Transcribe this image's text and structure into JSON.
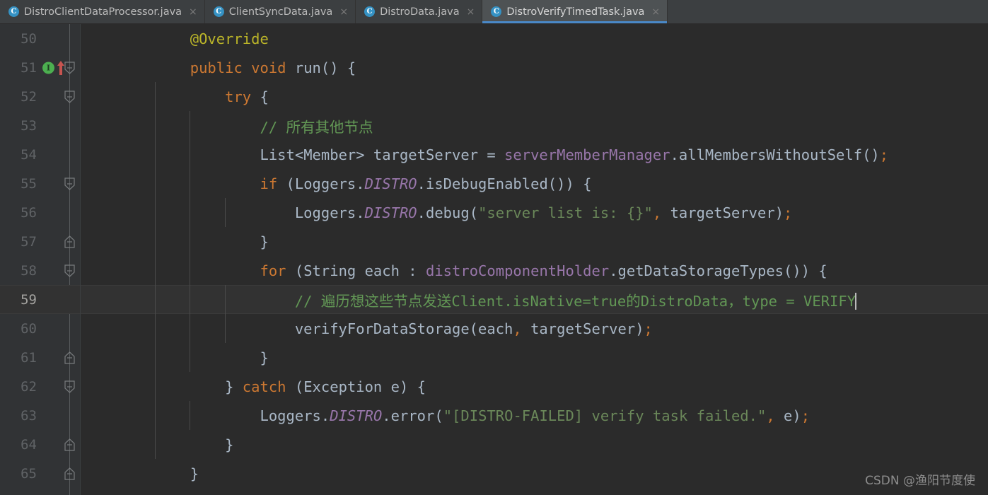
{
  "window": {
    "theme": "darcula",
    "colors": {
      "editor_bg": "#2b2b2b",
      "gutter_bg": "#313335",
      "tabbar_bg": "#3c3f41",
      "active_tab_bg": "#4e5254",
      "active_tab_underline": "#4a88c7",
      "current_line_bg": "#323232",
      "keyword": "#cc7832",
      "annotation": "#bbb529",
      "comment": "#629755",
      "string": "#6a8759",
      "field": "#9876aa",
      "default_text": "#a9b7c6",
      "line_number": "#606366",
      "current_line_number": "#a4a3a0",
      "implements_marker": "#4caf50",
      "modified_marker": "#c75450"
    }
  },
  "tabs": [
    {
      "label": "DistroClientDataProcessor.java",
      "icon": "java-class-icon",
      "icon_letter": "C",
      "close_glyph": "×",
      "active": false
    },
    {
      "label": "ClientSyncData.java",
      "icon": "java-class-icon",
      "icon_letter": "C",
      "close_glyph": "×",
      "active": false
    },
    {
      "label": "DistroData.java",
      "icon": "java-class-icon",
      "icon_letter": "C",
      "close_glyph": "×",
      "active": false
    },
    {
      "label": "DistroVerifyTimedTask.java",
      "icon": "java-class-icon",
      "icon_letter": "C",
      "close_glyph": "×",
      "active": true
    }
  ],
  "editor": {
    "current_line": 59,
    "caret_line": 59,
    "caret_column_after": "VERIFY",
    "lines": [
      {
        "number": "50",
        "current": false,
        "fold": null,
        "markers": [],
        "indent_guides": [],
        "tokens": [
          {
            "t": "        ",
            "c": "plain"
          },
          {
            "t": "@Override",
            "c": "anno"
          }
        ]
      },
      {
        "number": "51",
        "current": false,
        "fold": "start",
        "markers": [
          "implements-marker",
          "modified-arrow-marker"
        ],
        "indent_guides": [],
        "tokens": [
          {
            "t": "        ",
            "c": "plain"
          },
          {
            "t": "public",
            "c": "kw"
          },
          {
            "t": " ",
            "c": "plain"
          },
          {
            "t": "void",
            "c": "kw"
          },
          {
            "t": " ",
            "c": "plain"
          },
          {
            "t": "run",
            "c": "plain"
          },
          {
            "t": "() {",
            "c": "plain"
          }
        ]
      },
      {
        "number": "52",
        "current": false,
        "fold": "start",
        "markers": [],
        "indent_guides": [
          1
        ],
        "tokens": [
          {
            "t": "            ",
            "c": "plain"
          },
          {
            "t": "try",
            "c": "kw"
          },
          {
            "t": " {",
            "c": "plain"
          }
        ]
      },
      {
        "number": "53",
        "current": false,
        "fold": null,
        "markers": [],
        "indent_guides": [
          1,
          2
        ],
        "tokens": [
          {
            "t": "                ",
            "c": "plain"
          },
          {
            "t": "// 所有其他节点",
            "c": "cmt"
          }
        ]
      },
      {
        "number": "54",
        "current": false,
        "fold": null,
        "markers": [],
        "indent_guides": [
          1,
          2
        ],
        "tokens": [
          {
            "t": "                ",
            "c": "plain"
          },
          {
            "t": "List<Member> targetServer = ",
            "c": "plain"
          },
          {
            "t": "serverMemberManager",
            "c": "fld"
          },
          {
            "t": ".allMembersWithoutSelf()",
            "c": "plain"
          },
          {
            "t": ";",
            "c": "semi"
          }
        ]
      },
      {
        "number": "55",
        "current": false,
        "fold": "start",
        "markers": [],
        "indent_guides": [
          1,
          2
        ],
        "tokens": [
          {
            "t": "                ",
            "c": "plain"
          },
          {
            "t": "if",
            "c": "kw"
          },
          {
            "t": " (Loggers.",
            "c": "plain"
          },
          {
            "t": "DISTRO",
            "c": "sfld"
          },
          {
            "t": ".isDebugEnabled()) {",
            "c": "plain"
          }
        ]
      },
      {
        "number": "56",
        "current": false,
        "fold": null,
        "markers": [],
        "indent_guides": [
          1,
          2,
          3
        ],
        "tokens": [
          {
            "t": "                    ",
            "c": "plain"
          },
          {
            "t": "Loggers.",
            "c": "plain"
          },
          {
            "t": "DISTRO",
            "c": "sfld"
          },
          {
            "t": ".debug(",
            "c": "plain"
          },
          {
            "t": "\"server list is: {}\"",
            "c": "str"
          },
          {
            "t": ",",
            "c": "semi"
          },
          {
            "t": " targetServer)",
            "c": "plain"
          },
          {
            "t": ";",
            "c": "semi"
          }
        ]
      },
      {
        "number": "57",
        "current": false,
        "fold": "end",
        "markers": [],
        "indent_guides": [
          1,
          2
        ],
        "tokens": [
          {
            "t": "                }",
            "c": "plain"
          }
        ]
      },
      {
        "number": "58",
        "current": false,
        "fold": "start",
        "markers": [],
        "indent_guides": [
          1,
          2
        ],
        "tokens": [
          {
            "t": "                ",
            "c": "plain"
          },
          {
            "t": "for",
            "c": "kw"
          },
          {
            "t": " (String each : ",
            "c": "plain"
          },
          {
            "t": "distroComponentHolder",
            "c": "fld"
          },
          {
            "t": ".getDataStorageTypes()) {",
            "c": "plain"
          }
        ]
      },
      {
        "number": "59",
        "current": true,
        "fold": null,
        "markers": [],
        "indent_guides": [
          1,
          2,
          3
        ],
        "tokens": [
          {
            "t": "                    ",
            "c": "plain"
          },
          {
            "t": "// 遍历想这些节点发送Client.isNative=true的DistroData，type = VERIFY",
            "c": "cmt"
          }
        ]
      },
      {
        "number": "60",
        "current": false,
        "fold": null,
        "markers": [],
        "indent_guides": [
          1,
          2,
          3
        ],
        "tokens": [
          {
            "t": "                    ",
            "c": "plain"
          },
          {
            "t": "verifyForDataStorage(each",
            "c": "plain"
          },
          {
            "t": ",",
            "c": "semi"
          },
          {
            "t": " targetServer)",
            "c": "plain"
          },
          {
            "t": ";",
            "c": "semi"
          }
        ]
      },
      {
        "number": "61",
        "current": false,
        "fold": "end",
        "markers": [],
        "indent_guides": [
          1,
          2
        ],
        "tokens": [
          {
            "t": "                }",
            "c": "plain"
          }
        ]
      },
      {
        "number": "62",
        "current": false,
        "fold": "start",
        "markers": [],
        "indent_guides": [
          1
        ],
        "tokens": [
          {
            "t": "            } ",
            "c": "plain"
          },
          {
            "t": "catch",
            "c": "kw"
          },
          {
            "t": " (Exception e) {",
            "c": "plain"
          }
        ]
      },
      {
        "number": "63",
        "current": false,
        "fold": null,
        "markers": [],
        "indent_guides": [
          1,
          2
        ],
        "tokens": [
          {
            "t": "                ",
            "c": "plain"
          },
          {
            "t": "Loggers.",
            "c": "plain"
          },
          {
            "t": "DISTRO",
            "c": "sfld"
          },
          {
            "t": ".error(",
            "c": "plain"
          },
          {
            "t": "\"[DISTRO-FAILED] verify task failed.\"",
            "c": "str"
          },
          {
            "t": ",",
            "c": "semi"
          },
          {
            "t": " e)",
            "c": "plain"
          },
          {
            "t": ";",
            "c": "semi"
          }
        ]
      },
      {
        "number": "64",
        "current": false,
        "fold": "end",
        "markers": [],
        "indent_guides": [
          1
        ],
        "tokens": [
          {
            "t": "            }",
            "c": "plain"
          }
        ]
      },
      {
        "number": "65",
        "current": false,
        "fold": "end",
        "markers": [],
        "indent_guides": [],
        "tokens": [
          {
            "t": "        }",
            "c": "plain"
          }
        ]
      }
    ]
  },
  "watermark": {
    "text": "CSDN @渔阳节度使"
  }
}
